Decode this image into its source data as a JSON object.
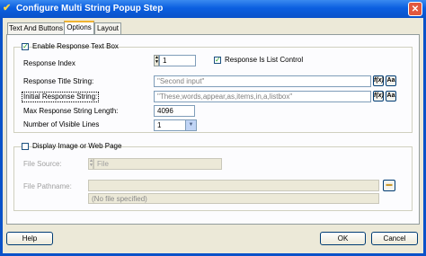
{
  "window": {
    "title": "Configure Multi String Popup Step",
    "close_glyph": "✕"
  },
  "tabs": [
    {
      "label": "Text And Buttons"
    },
    {
      "label": "Options"
    },
    {
      "label": "Layout"
    }
  ],
  "response_group": {
    "legend": "Enable Response Text Box",
    "enabled": true,
    "response_index": {
      "label": "Response Index",
      "value": "1"
    },
    "is_list_control": {
      "label": "Response Is List Control",
      "checked": true
    },
    "title_string": {
      "label": "Response Title String:",
      "value": "\"Second input\""
    },
    "initial_string": {
      "label": "Initial Response String:",
      "value": "\"These,words,appear,as,items,in,a,listbox\""
    },
    "max_length": {
      "label": "Max Response String Length:",
      "value": "4096"
    },
    "visible_lines": {
      "label": "Number of Visible Lines",
      "value": "1"
    },
    "fx_label": "f(x)",
    "aa_label": "Aa"
  },
  "image_group": {
    "legend": "Display Image or Web Page",
    "enabled": false,
    "file_source": {
      "label": "File Source:",
      "value": "File"
    },
    "file_pathname": {
      "label": "File Pathname:",
      "status": "(No file specified)"
    }
  },
  "buttons": {
    "help": "Help",
    "ok": "OK",
    "cancel": "Cancel"
  },
  "colors": {
    "titlebar": "#0a52c9",
    "tab_highlight": "#f0b330",
    "dialog_bg": "#ece9d8"
  }
}
